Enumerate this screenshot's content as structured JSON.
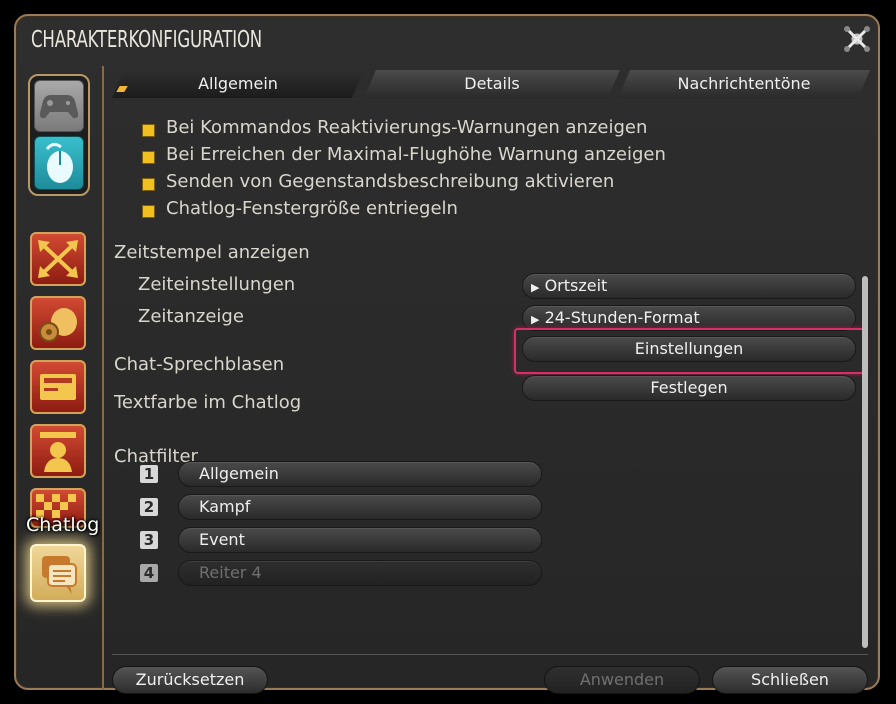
{
  "window": {
    "title": "CHARAKTERKONFIGURATION"
  },
  "tabs": [
    {
      "label": "Allgemein",
      "active": true
    },
    {
      "label": "Details",
      "active": false
    },
    {
      "label": "Nachrichtentöne",
      "active": false
    }
  ],
  "sidebar": {
    "tooltip": "Chatlog",
    "modes": [
      {
        "icon": "gamepad-icon"
      },
      {
        "icon": "mouse-icon"
      }
    ],
    "categories": [
      {
        "icon": "crossed-arrows-icon"
      },
      {
        "icon": "gear-bag-icon"
      },
      {
        "icon": "card-icon"
      },
      {
        "icon": "character-icon"
      },
      {
        "icon": "checker-icon"
      },
      {
        "icon": "chat-bubble-icon",
        "active": true
      }
    ]
  },
  "options": [
    {
      "label": "Bei Kommandos Reaktivierungs-Warnungen anzeigen",
      "checked": true
    },
    {
      "label": "Bei Erreichen der Maximal-Flughöhe Warnung anzeigen",
      "checked": true
    },
    {
      "label": "Senden von Gegenstandsbeschreibung aktivieren",
      "checked": true
    },
    {
      "label": "Chatlog-Fenstergröße entriegeln",
      "checked": true
    }
  ],
  "timestamp": {
    "heading": "Zeitstempel anzeigen",
    "settings_label": "Zeiteinstellungen",
    "settings_value": "Ortszeit",
    "display_label": "Zeitanzeige",
    "display_value": "24-Stunden-Format"
  },
  "bubbles": {
    "label": "Chat-Sprechblasen",
    "button": "Einstellungen"
  },
  "textcolor": {
    "label": "Textfarbe im Chatlog",
    "button": "Festlegen"
  },
  "chatfilter": {
    "heading": "Chatfilter",
    "items": [
      {
        "num": "1",
        "label": "Allgemein",
        "enabled": true
      },
      {
        "num": "2",
        "label": "Kampf",
        "enabled": true
      },
      {
        "num": "3",
        "label": "Event",
        "enabled": true
      },
      {
        "num": "4",
        "label": "Reiter 4",
        "enabled": false
      }
    ]
  },
  "footer": {
    "reset": "Zurücksetzen",
    "apply": "Anwenden",
    "close": "Schließen"
  },
  "colors": {
    "accent": "#f0c020",
    "highlight": "#d6306b",
    "frame": "#9a7b57"
  }
}
